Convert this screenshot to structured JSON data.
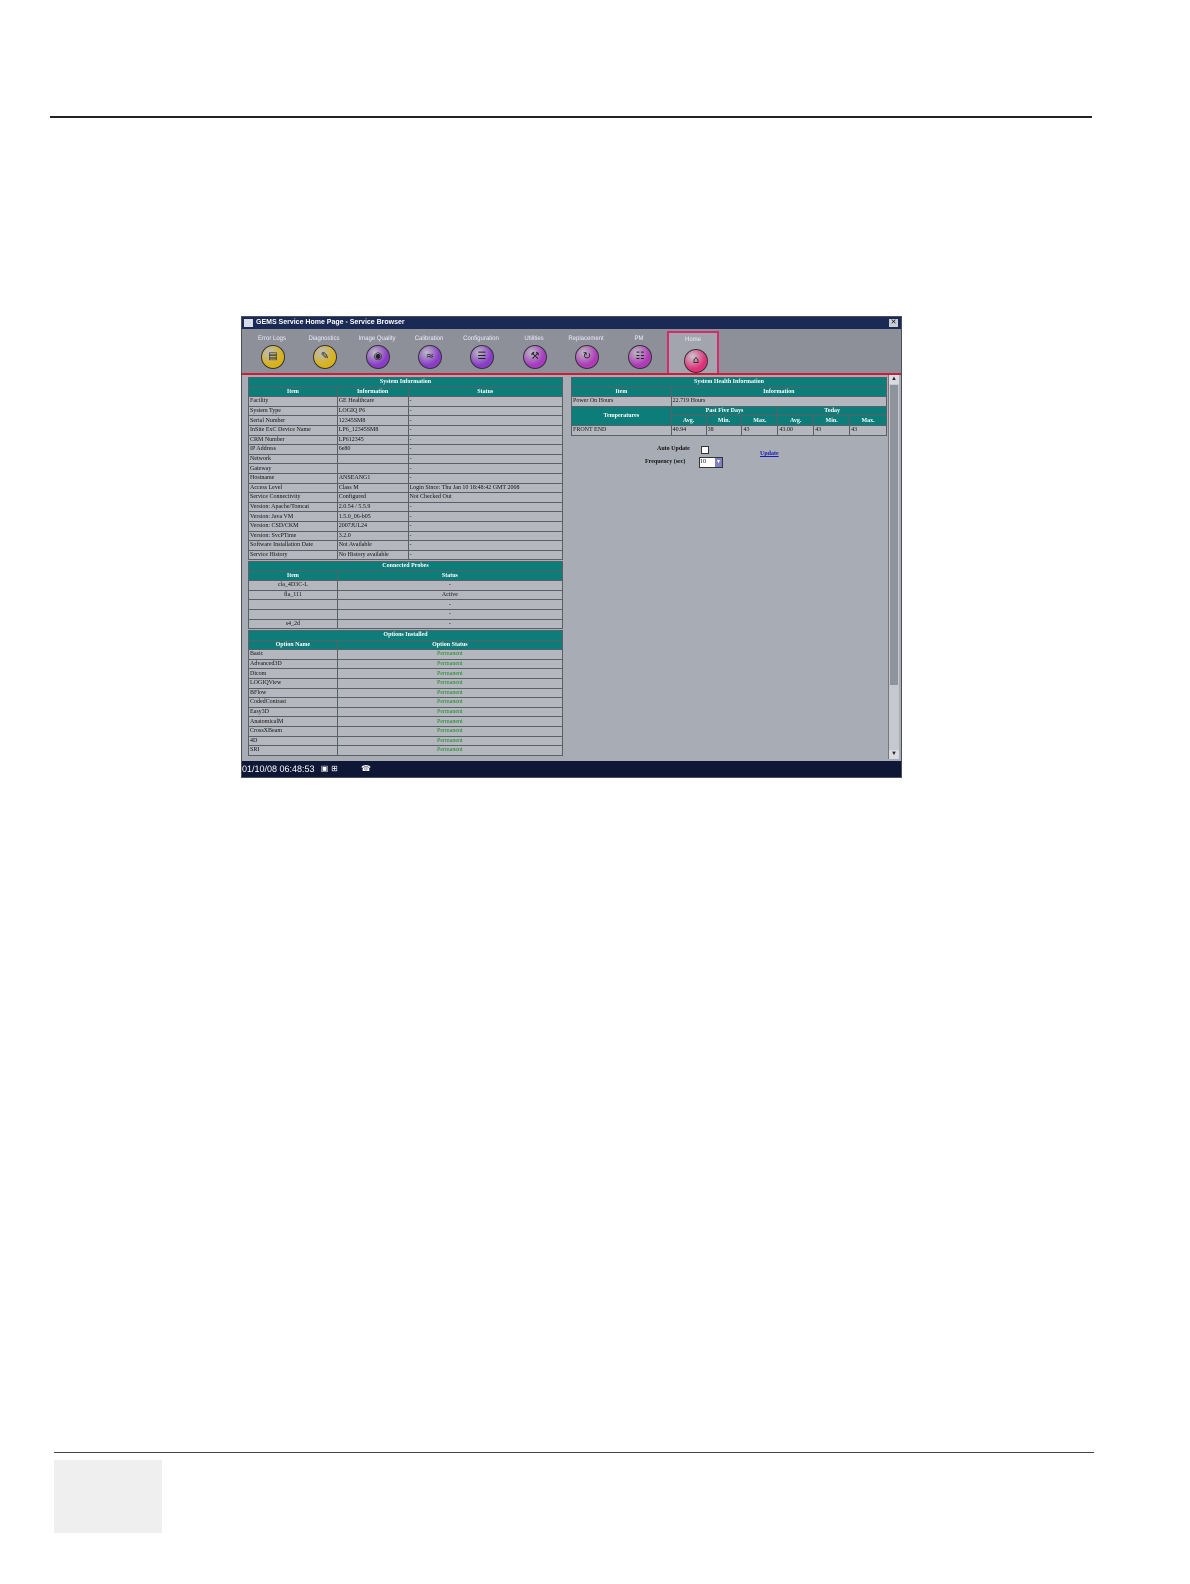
{
  "window": {
    "title": "GEMS Service Home Page - Service Browser",
    "close_glyph": "✕"
  },
  "toolbar": {
    "buttons": [
      {
        "label": "Error Logs",
        "icon": "log-icon",
        "glyph": "▤",
        "color": "#d9b21a"
      },
      {
        "label": "Diagnostics",
        "icon": "diagnostics-icon",
        "glyph": "✎",
        "color": "#d9b21a"
      },
      {
        "label": "Image Quality",
        "icon": "image-quality-icon",
        "glyph": "◉",
        "color": "#8a3cc8"
      },
      {
        "label": "Calibration",
        "icon": "calibration-icon",
        "glyph": "≈",
        "color": "#8a3cc8"
      },
      {
        "label": "Configuration",
        "icon": "configuration-icon",
        "glyph": "☰",
        "color": "#8a3cc8"
      },
      {
        "label": "Utilities",
        "icon": "utilities-icon",
        "glyph": "⚒",
        "color": "#a63ac0"
      },
      {
        "label": "Replacement",
        "icon": "replacement-icon",
        "glyph": "↻",
        "color": "#b03ab8"
      },
      {
        "label": "PM",
        "icon": "pm-icon",
        "glyph": "☷",
        "color": "#b03ab8"
      },
      {
        "label": "Home",
        "icon": "home-icon",
        "glyph": "⌂",
        "color": "#e0307a"
      }
    ]
  },
  "system_info": {
    "title": "System Information",
    "headers": [
      "Item",
      "Information",
      "Status"
    ],
    "rows": [
      [
        "Facility",
        "GE Healthcare",
        "-"
      ],
      [
        "System Type",
        "LOGIQ P6",
        "-"
      ],
      [
        "Serial Number",
        "12345SM8",
        "-"
      ],
      [
        "InSite ExC Device Name",
        "LP6_12345SM8",
        "-"
      ],
      [
        "CRM Number",
        "LP612345",
        "-"
      ],
      [
        "IP Address",
        "6e80",
        "-"
      ],
      [
        "Network",
        "",
        "-"
      ],
      [
        "Gateway",
        "",
        "-"
      ],
      [
        "Hostname",
        "ANSEANG1",
        "-"
      ],
      [
        "Access Level",
        "Class M",
        "Login Since: Thu Jan 10 18:48:42 GMT 2008"
      ],
      [
        "Service Connectivity",
        "Configured",
        "Not Checked Out"
      ],
      [
        "Version: Apache/Tomcat",
        "2.0.54 / 5.5.9",
        "-"
      ],
      [
        "Version: Java VM",
        "1.5.0_06-b05",
        "-"
      ],
      [
        "Version: CSD/CKM",
        "2007JUL24",
        "-"
      ],
      [
        "Version: SvcPTime",
        "3.2.0",
        "-"
      ],
      [
        "Software Installation Date",
        "Not Available",
        "-"
      ],
      [
        "Service History",
        "No History available",
        "-"
      ]
    ]
  },
  "probes": {
    "title": "Connected Probes",
    "headers": [
      "Item",
      "Status"
    ],
    "rows": [
      [
        "cla_4D3C-L",
        "-"
      ],
      [
        "fla_111",
        "Active"
      ],
      [
        "",
        "-"
      ],
      [
        "",
        "-"
      ],
      [
        "s4_2d",
        "-"
      ]
    ]
  },
  "options": {
    "title": "Options Installed",
    "headers": [
      "Option Name",
      "Option Status"
    ],
    "rows": [
      [
        "Basic",
        "Permanent"
      ],
      [
        "Advanced3D",
        "Permanent"
      ],
      [
        "Dicom",
        "Permanent"
      ],
      [
        "LOGIQView",
        "Permanent"
      ],
      [
        "BFlow",
        "Permanent"
      ],
      [
        "CodedContrast",
        "Permanent"
      ],
      [
        "Easy3D",
        "Permanent"
      ],
      [
        "AnatomicalM",
        "Permanent"
      ],
      [
        "CrossXBeam",
        "Permanent"
      ],
      [
        "4D",
        "Permanent"
      ],
      [
        "SRI",
        "Permanent"
      ]
    ]
  },
  "health": {
    "title": "System Health Information",
    "headers": [
      "Item",
      "Information"
    ],
    "power_label": "Power On Hours",
    "power_value": "22.719 Hours",
    "temps_label": "Temperatures",
    "past_label": "Past Five Days",
    "today_label": "Today",
    "sub_headers": [
      "Avg.",
      "Min.",
      "Max.",
      "Avg.",
      "Min.",
      "Max."
    ],
    "row": [
      "FRONT END",
      "40.94",
      "38",
      "43",
      "43.00",
      "43",
      "43"
    ]
  },
  "controls": {
    "auto_update_label": "Auto Update",
    "frequency_label": "Frequency (sec)",
    "frequency_value": "10",
    "update_link": "Update"
  },
  "taskbar": {
    "clock": "01/10/08 06:48:53"
  }
}
